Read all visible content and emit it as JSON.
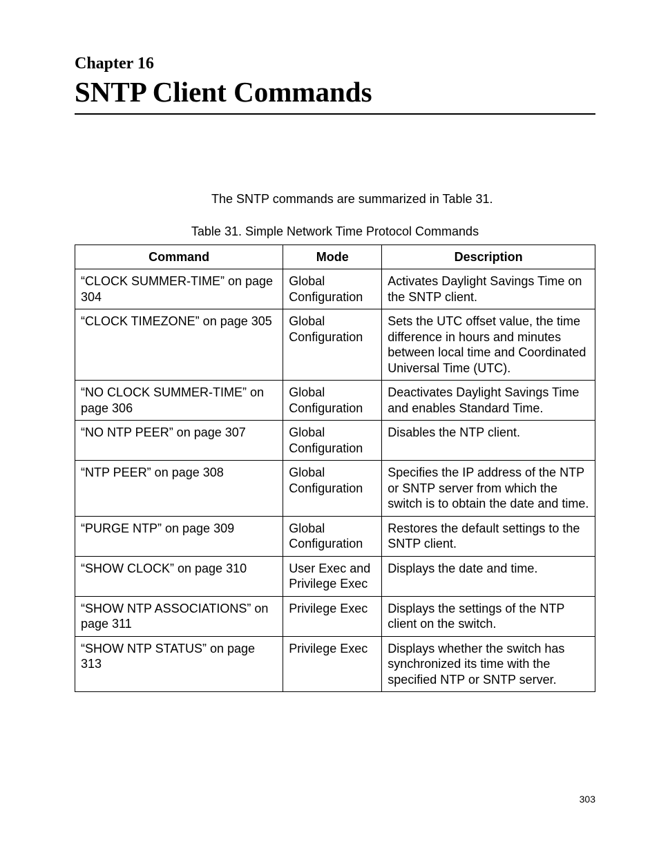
{
  "chapter_label": "Chapter 16",
  "chapter_title": "SNTP Client Commands",
  "intro_text": "The SNTP commands are summarized in Table 31.",
  "table_caption": "Table 31. Simple Network Time Protocol Commands",
  "headers": {
    "command": "Command",
    "mode": "Mode",
    "description": "Description"
  },
  "rows": [
    {
      "command": "“CLOCK SUMMER-TIME” on page 304",
      "mode": "Global Configuration",
      "description": "Activates Daylight Savings Time on the SNTP client."
    },
    {
      "command": "“CLOCK TIMEZONE” on page 305",
      "mode": "Global Configuration",
      "description": "Sets the UTC offset value, the time difference in hours and minutes between local time and Coordinated Universal Time (UTC)."
    },
    {
      "command": "“NO CLOCK SUMMER-TIME” on page 306",
      "mode": "Global Configuration",
      "description": "Deactivates Daylight Savings Time and enables Standard Time."
    },
    {
      "command": "“NO NTP PEER” on page 307",
      "mode": "Global Configuration",
      "description": "Disables the NTP client."
    },
    {
      "command": "“NTP PEER” on page 308",
      "mode": "Global Configuration",
      "description": "Specifies the IP address of the NTP or SNTP server from which the switch is to obtain the date and time."
    },
    {
      "command": "“PURGE NTP” on page 309",
      "mode": "Global Configuration",
      "description": "Restores the default settings to the SNTP client."
    },
    {
      "command": "“SHOW CLOCK” on page 310",
      "mode": "User Exec and Privilege Exec",
      "description": "Displays the date and time."
    },
    {
      "command": "“SHOW NTP ASSOCIATIONS” on page 311",
      "mode": "Privilege Exec",
      "description": "Displays the settings of the NTP client on the switch."
    },
    {
      "command": "“SHOW NTP STATUS” on page 313",
      "mode": "Privilege Exec",
      "description": "Displays whether the switch has synchronized its time with the specified NTP or SNTP server."
    }
  ],
  "page_number": "303"
}
